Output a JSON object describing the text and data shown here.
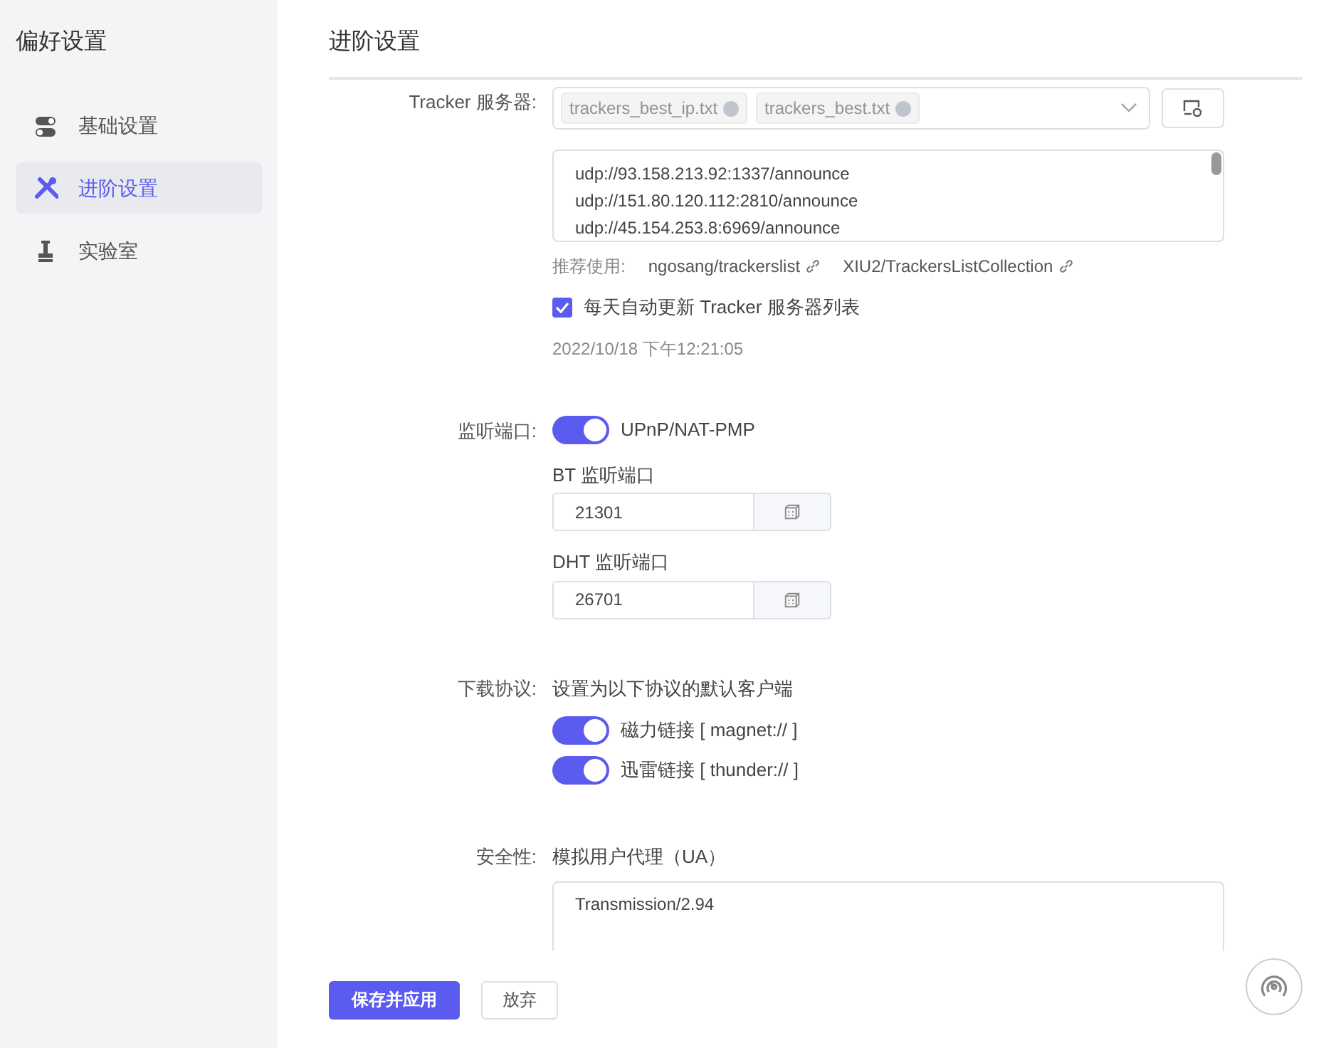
{
  "sidebar": {
    "title": "偏好设置",
    "items": [
      {
        "label": "基础设置",
        "selected": false
      },
      {
        "label": "进阶设置",
        "selected": true
      },
      {
        "label": "实验室",
        "selected": false
      }
    ]
  },
  "page_title": "进阶设置",
  "tracker": {
    "label": "Tracker 服务器:",
    "tags": [
      "trackers_best_ip.txt",
      "trackers_best.txt"
    ],
    "urls": [
      "udp://93.158.213.92:1337/announce",
      "udp://151.80.120.112:2810/announce",
      "udp://45.154.253.8:6969/announce"
    ],
    "recommend_label": "推荐使用:",
    "links": [
      "ngosang/trackerslist",
      "XIU2/TrackersListCollection"
    ],
    "auto_update": {
      "label": "每天自动更新 Tracker 服务器列表",
      "checked": true
    },
    "updated_at": "2022/10/18 下午12:21:05"
  },
  "listen": {
    "label": "监听端口:",
    "upnp": {
      "label": "UPnP/NAT-PMP",
      "on": true
    },
    "ports": [
      {
        "label": "BT 监听端口",
        "value": "21301"
      },
      {
        "label": "DHT 监听端口",
        "value": "26701"
      }
    ]
  },
  "protocols": {
    "label": "下载协议:",
    "description": "设置为以下协议的默认客户端",
    "items": [
      {
        "label": "磁力链接 [ magnet:// ]",
        "on": true
      },
      {
        "label": "迅雷链接 [ thunder:// ]",
        "on": true
      }
    ]
  },
  "security": {
    "label": "安全性:",
    "ua_label": "模拟用户代理（UA）",
    "ua_value": "Transmission/2.94"
  },
  "buttons": {
    "save": "保存并应用",
    "discard": "放弃"
  }
}
